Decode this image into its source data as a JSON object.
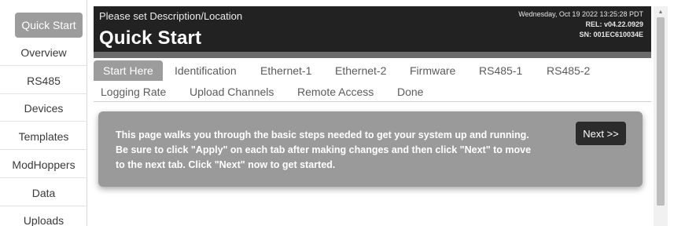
{
  "sidebar": {
    "items": [
      {
        "label": "Quick Start",
        "active": true
      },
      {
        "label": "Overview"
      },
      {
        "label": "RS485"
      },
      {
        "label": "Devices"
      },
      {
        "label": "Templates"
      },
      {
        "label": "ModHoppers"
      },
      {
        "label": "Data"
      },
      {
        "label": "Uploads"
      }
    ]
  },
  "header": {
    "description": "Please set Description/Location",
    "title": "Quick Start",
    "datetime": "Wednesday, Oct 19 2022 13:25:28 PDT",
    "rel": "REL: v04.22.0929",
    "sn": "SN: 001EC610034E"
  },
  "tabs": [
    {
      "label": "Start Here",
      "active": true
    },
    {
      "label": "Identification"
    },
    {
      "label": "Ethernet-1"
    },
    {
      "label": "Ethernet-2"
    },
    {
      "label": "Firmware"
    },
    {
      "label": "RS485-1"
    },
    {
      "label": "RS485-2"
    },
    {
      "label": "Logging Rate"
    },
    {
      "label": "Upload Channels"
    },
    {
      "label": "Remote Access"
    },
    {
      "label": "Done"
    }
  ],
  "content": {
    "message": "This page walks you through the basic steps needed to get your system up and running. Be sure to click \"Apply\" on each tab after making changes and then click \"Next\" to move to the next tab. Click \"Next\" now to get started.",
    "next_label": "Next >>"
  },
  "colors": {
    "header_bg": "#222222",
    "active_bg": "#9c9c9c",
    "card_bg": "#9a9a9a",
    "button_bg": "#2b2b2b"
  }
}
